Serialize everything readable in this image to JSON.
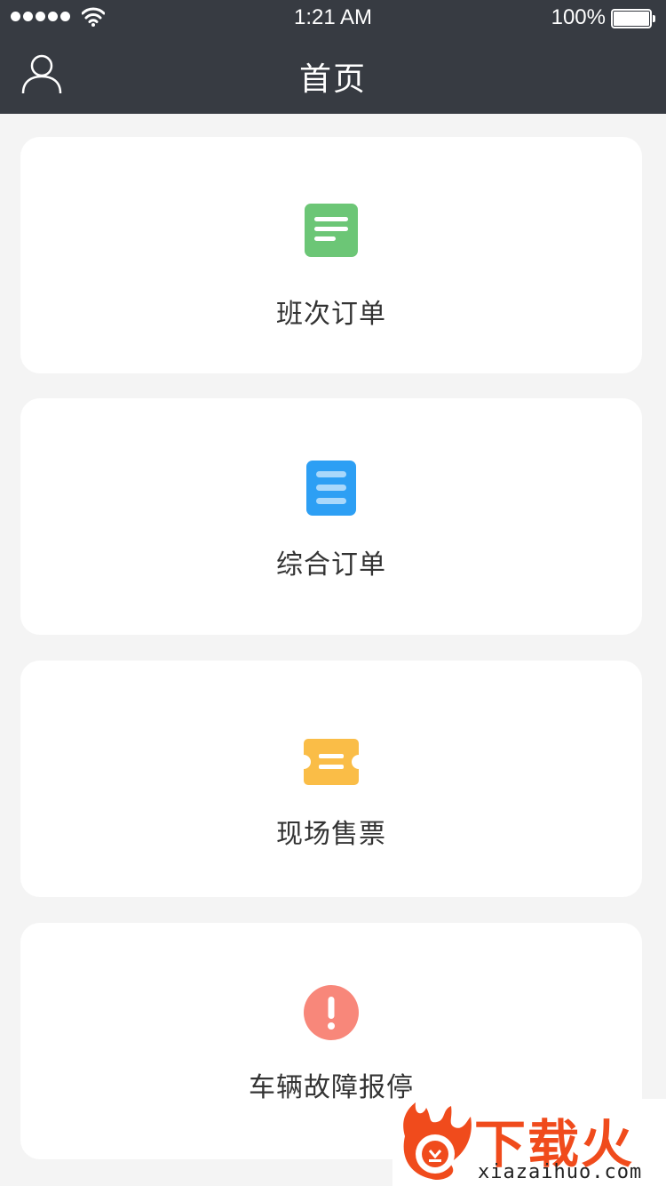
{
  "status_bar": {
    "time": "1:21 AM",
    "battery": "100%"
  },
  "nav": {
    "title": "首页",
    "left_icon": "user-icon"
  },
  "menu": [
    {
      "label": "班次订单",
      "icon": "order-list-icon",
      "color": "#6cc676"
    },
    {
      "label": "综合订单",
      "icon": "document-icon",
      "color": "#2d9ff4"
    },
    {
      "label": "现场售票",
      "icon": "ticket-icon",
      "color": "#fabd47"
    },
    {
      "label": "车辆故障报停",
      "icon": "alert-icon",
      "color": "#f8877a"
    }
  ],
  "watermark": {
    "cn": "下载火",
    "en": "xiazaihuo.com"
  },
  "colors": {
    "header_bg": "#373b42",
    "page_bg": "#f4f4f4",
    "card_bg": "#ffffff",
    "watermark_red": "#f04b1c"
  }
}
